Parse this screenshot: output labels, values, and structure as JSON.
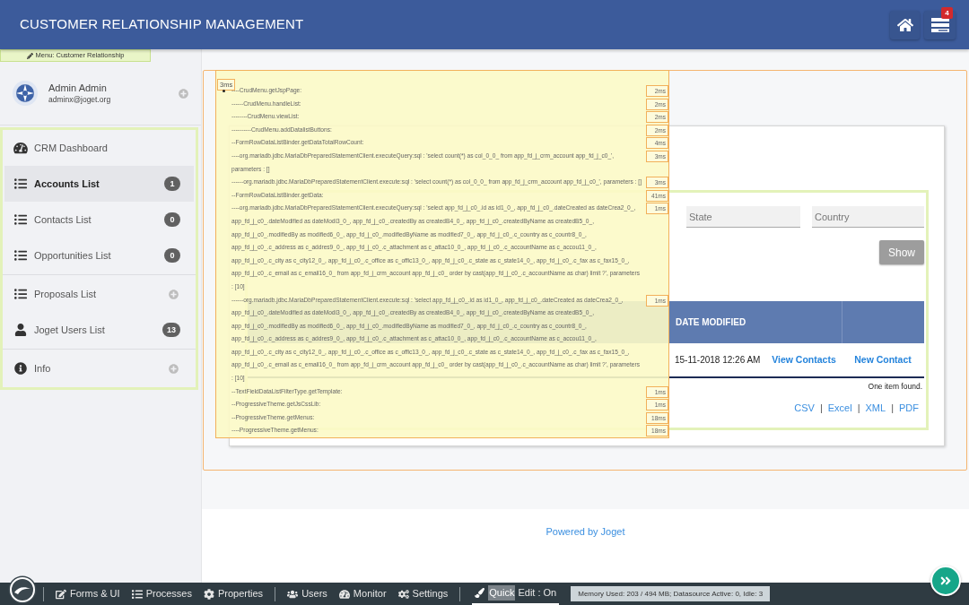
{
  "header": {
    "title": "CUSTOMER RELATIONSHIP MANAGEMENT",
    "notification_count": "4"
  },
  "sidebar": {
    "menu_tag": "Menu: Customer Relationship",
    "user": {
      "name": "Admin Admin",
      "email": "adminx@joget.org",
      "expandable": true
    },
    "menu_groups": [
      {
        "items": [
          {
            "label": "CRM Dashboard",
            "kind": "dashboard",
            "selected": false,
            "expandable": false
          },
          {
            "label": "Accounts List",
            "kind": "list",
            "badge": "1",
            "selected": true,
            "expandable": false
          },
          {
            "label": "Contacts List",
            "kind": "list",
            "badge": "0",
            "selected": false,
            "expandable": false
          },
          {
            "label": "Opportunities List",
            "kind": "list",
            "badge": "0",
            "selected": false,
            "expandable": false
          }
        ]
      },
      {
        "items": [
          {
            "label": "Proposals List",
            "kind": "list",
            "selected": false,
            "expandable": true
          },
          {
            "label": "Joget Users List",
            "kind": "user",
            "badge": "13",
            "selected": false,
            "expandable": false
          }
        ]
      },
      {
        "items": [
          {
            "label": "Info",
            "kind": "info",
            "selected": false,
            "expandable": true
          }
        ]
      }
    ]
  },
  "debug": {
    "total_time": "3ms",
    "entries": [
      {
        "text": "----CrudMenu.getJspPage:",
        "time": "2ms",
        "bullet": true
      },
      {
        "text": "------CrudMenu.handleList:",
        "time": "2ms",
        "bullet": false
      },
      {
        "text": "--------CrudMenu.viewList:",
        "time": "2ms",
        "bullet": false
      },
      {
        "text": "----------CrudMenu.addDatalistButtons:",
        "time": "2ms",
        "bullet": false
      },
      {
        "text": "--FormRowDataListBinder.getDataTotalRowCount:",
        "time": "4ms",
        "bullet": false
      },
      {
        "text": "----org.mariadb.jdbc.MariaDbPreparedStatementClient.executeQuery:sql : 'select count(*) as col_0_0_ from app_fd_j_crm_account app_fd_j_c0_', parameters : []",
        "time": "3ms",
        "bullet": false
      },
      {
        "text": "------org.mariadb.jdbc.MariaDbPreparedStatementClient.execute:sql : 'select count(*) as col_0_0_ from app_fd_j_crm_account app_fd_j_c0_', parameters : []",
        "time": "3ms",
        "bullet": false
      },
      {
        "text": "--FormRowDataListBinder.getData:",
        "time": "41ms",
        "bullet": false
      },
      {
        "text": "----org.mariadb.jdbc.MariaDbPreparedStatementClient.executeQuery:sql : 'select app_fd_j_c0_.id as id1_0_, app_fd_j_c0_.dateCreated as dateCrea2_0_, app_fd_j_c0_.dateModified as dateModi3_0_, app_fd_j_c0_.createdBy as createdB4_0_, app_fd_j_c0_.createdByName as createdB5_0_, app_fd_j_c0_.modifiedBy as modified6_0_, app_fd_j_c0_.modifiedByName as modified7_0_, app_fd_j_c0_.c_country as c_countr8_0_, app_fd_j_c0_.c_address as c_addres9_0_, app_fd_j_c0_.c_attachment as c_attac10_0_, app_fd_j_c0_.c_accountName as c_accou11_0_, app_fd_j_c0_.c_city as c_city12_0_, app_fd_j_c0_.c_office as c_offic13_0_, app_fd_j_c0_.c_state as c_state14_0_, app_fd_j_c0_.c_fax as c_fax15_0_, app_fd_j_c0_.c_email as c_email16_0_ from app_fd_j_crm_account app_fd_j_c0_ order by cast(app_fd_j_c0_.c_accountName as char) limit ?', parameters : [10]",
        "time": "1ms",
        "bullet": false
      },
      {
        "text": "------org.mariadb.jdbc.MariaDbPreparedStatementClient.execute:sql : 'select app_fd_j_c0_.id as id1_0_, app_fd_j_c0_.dateCreated as dateCrea2_0_, app_fd_j_c0_.dateModified as dateModi3_0_, app_fd_j_c0_.createdBy as createdB4_0_, app_fd_j_c0_.createdByName as createdB5_0_, app_fd_j_c0_.modifiedBy as modified6_0_, app_fd_j_c0_.modifiedByName as modified7_0_, app_fd_j_c0_.c_country as c_countr8_0_, app_fd_j_c0_.c_address as c_addres9_0_, app_fd_j_c0_.c_attachment as c_attac10_0_, app_fd_j_c0_.c_accountName as c_accou11_0_, app_fd_j_c0_.c_city as c_city12_0_, app_fd_j_c0_.c_office as c_offic13_0_, app_fd_j_c0_.c_state as c_state14_0_, app_fd_j_c0_.c_fax as c_fax15_0_, app_fd_j_c0_.c_email as c_email16_0_ from app_fd_j_crm_account app_fd_j_c0_ order by cast(app_fd_j_c0_.c_accountName as char) limit ?', parameters : [10]",
        "time": "1ms",
        "bullet": false
      },
      {
        "text": "--TextFieldDataListFilterType.getTemplate:",
        "time": "1ms",
        "bullet": false
      },
      {
        "text": "--ProgressiveTheme.getJsCssLib:",
        "time": "1ms",
        "bullet": false
      },
      {
        "text": "--ProgressiveTheme.getMenus:",
        "time": "18ms",
        "bullet": false
      },
      {
        "text": "----ProgressiveTheme.getMenus:",
        "time": "18ms",
        "bullet": false
      }
    ]
  },
  "content": {
    "filters": [
      {
        "placeholder": "State"
      },
      {
        "placeholder": "Country"
      }
    ],
    "show_button": "Show",
    "table": {
      "columns": [
        "DATE MODIFIED"
      ],
      "rows": [
        {
          "date_modified": "15-11-2018 12:26 AM",
          "actions": [
            "View Contacts",
            "New Contact"
          ]
        }
      ]
    },
    "result_count": "One item found.",
    "exports": [
      {
        "label": "CSV",
        "separator": "|"
      },
      {
        "label": "Excel",
        "separator": "|"
      },
      {
        "label": "XML",
        "separator": "|"
      },
      {
        "label": "PDF"
      }
    ]
  },
  "footer": {
    "powered_by": "Powered by Joget"
  },
  "admin_bar": {
    "groups": [
      {
        "items": [
          {
            "label": "Forms & UI",
            "kind": "edit"
          },
          {
            "label": "Processes",
            "kind": "list"
          },
          {
            "label": "Properties",
            "kind": "gear"
          }
        ]
      },
      {
        "items": [
          {
            "label": "Users",
            "kind": "users"
          },
          {
            "label": "Monitor",
            "kind": "dashboard"
          },
          {
            "label": "Settings",
            "kind": "gears"
          }
        ]
      }
    ],
    "quick_edit": {
      "parts": [
        {
          "text": "Quick",
          "highlighted": true
        },
        {
          "text": "Edit : On",
          "highlighted": false
        }
      ]
    },
    "memory": "Memory Used: 203 / 494 MB; Datasource Active: 0, Idle: 3"
  }
}
